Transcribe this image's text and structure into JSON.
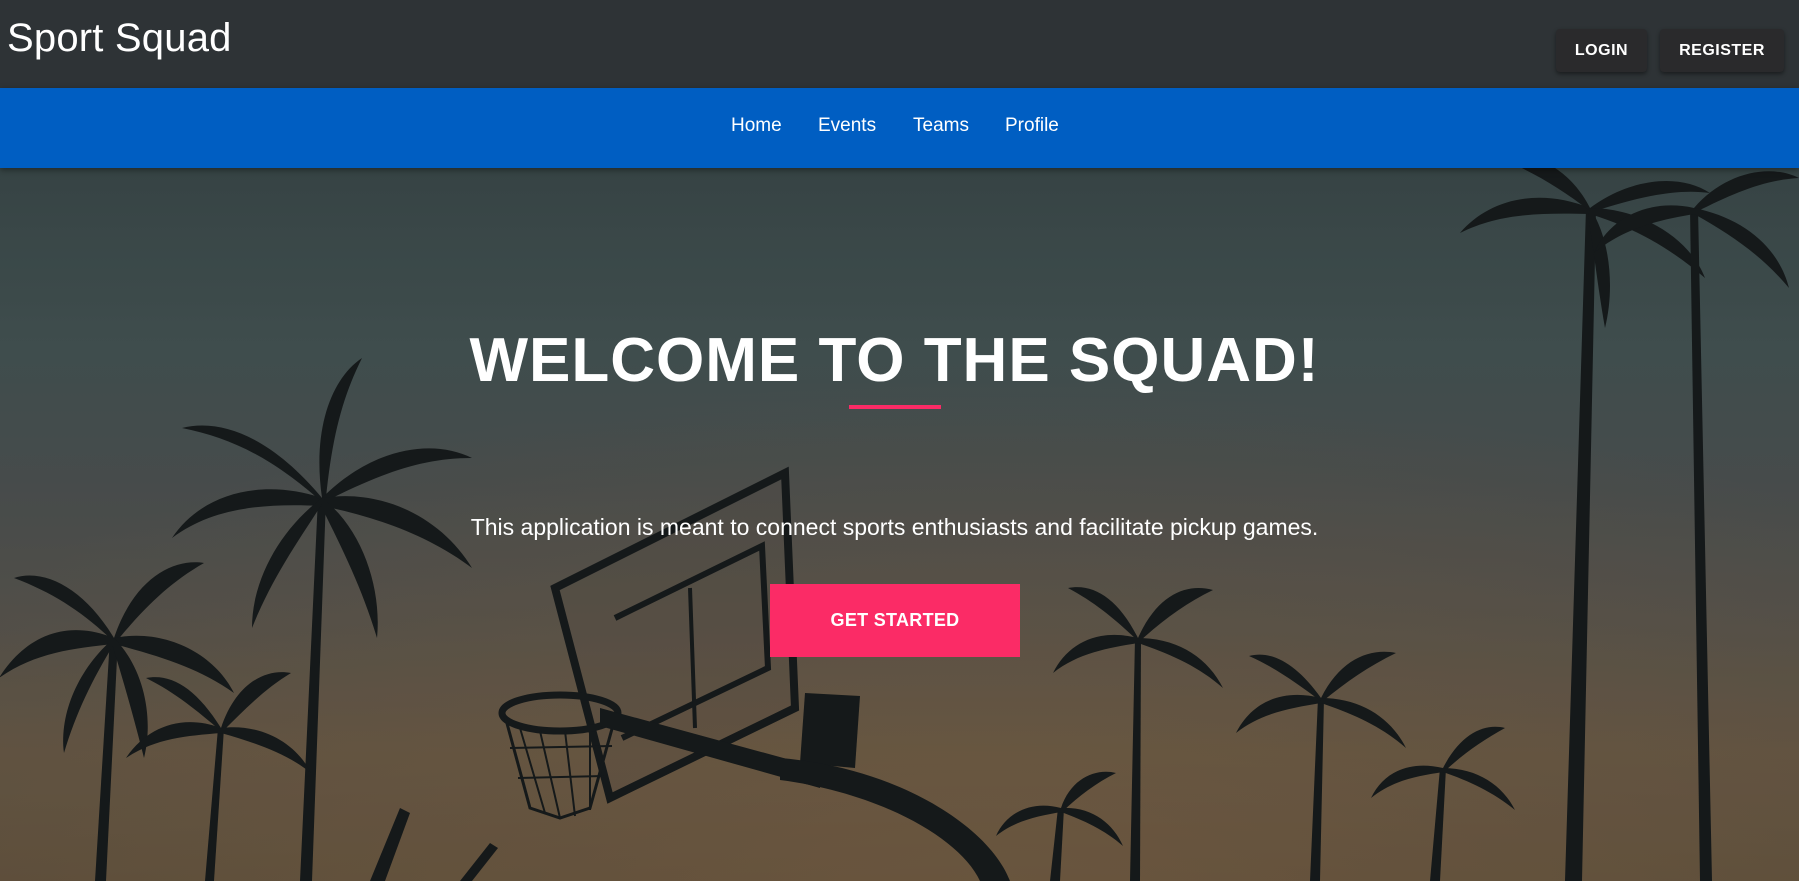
{
  "header": {
    "brand": "Sport Squad",
    "login_label": "LOGIN",
    "register_label": "REGISTER"
  },
  "nav": {
    "items": [
      {
        "label": "Home"
      },
      {
        "label": "Events"
      },
      {
        "label": "Teams"
      },
      {
        "label": "Profile"
      }
    ]
  },
  "hero": {
    "title": "WELCOME TO THE SQUAD!",
    "subtitle": "This application is meant to connect sports enthusiasts and facilitate pickup games.",
    "cta_label": "GET STARTED"
  },
  "colors": {
    "topbar": "#2e3336",
    "navbar": "#005ec2",
    "accent": "#fb2b66",
    "button_dark": "#2a2a2c"
  }
}
